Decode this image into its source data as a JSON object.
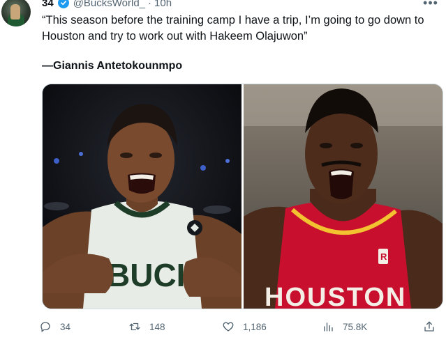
{
  "tweet": {
    "display_name_fragment": "34",
    "handle": "@BucksWorld_",
    "separator": "·",
    "time": "10h",
    "text": "“This season before the training camp I have a trip, I’m going to go down to Houston and try to work out with Hakeem Olajuwon”",
    "attribution": "—Giannis Antetokounmpo",
    "jersey_left": "BUCK",
    "jersey_right": "HOUSTON",
    "jersey_right_number_patch": "R"
  },
  "actions": {
    "replies": "34",
    "reposts": "148",
    "likes": "1,186",
    "views": "75.8K"
  },
  "colors": {
    "verified": "#1d9bf0",
    "muted_text": "#536471",
    "rockets_red": "#c8102e",
    "rockets_gold": "#f2c230",
    "bucks_green": "#00471b"
  },
  "icons": [
    "more-icon",
    "verified-icon",
    "reply-icon",
    "retweet-icon",
    "like-icon",
    "views-icon",
    "share-icon"
  ]
}
